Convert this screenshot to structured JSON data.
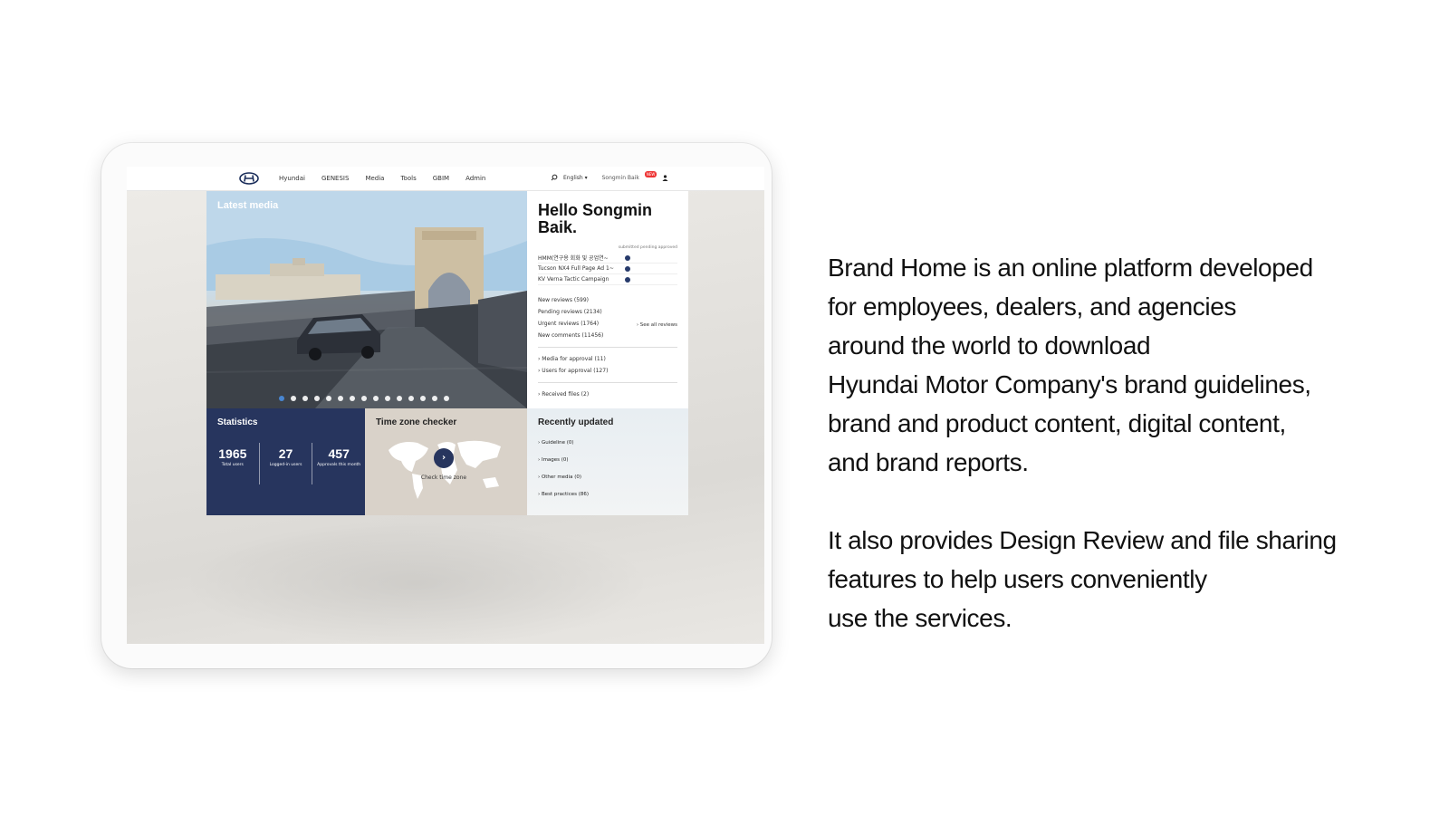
{
  "header": {
    "nav": [
      "Hyundai",
      "GENESIS",
      "Media",
      "Tools",
      "GBIM",
      "Admin"
    ],
    "language": "English",
    "user_name": "Songmin Baik",
    "badge": "NEW"
  },
  "hero": {
    "label": "Latest media",
    "slide_count": 15,
    "active_slide": 1
  },
  "welcome": {
    "greeting": "Hello Songmin Baik.",
    "legend": "submitted  pending  approved",
    "submissions": [
      "HMM(연구용 회화 및 공업연~",
      "Tucson NX4 Full Page Ad 1~",
      "KV Verna Tactic Campaign"
    ],
    "counts": [
      "New reviews (599)",
      "Pending reviews (2134)",
      "Urgent reviews (1764)",
      "New comments (11456)"
    ],
    "see_all": "› See all reviews",
    "approvals": [
      "› Media for approval (11)",
      "› Users for approval (127)"
    ],
    "received": "› Received files (2)"
  },
  "statistics": {
    "title": "Statistics",
    "items": [
      {
        "value": "1965",
        "label": "Total users"
      },
      {
        "value": "27",
        "label": "Logged-in users"
      },
      {
        "value": "457",
        "label": "Approvals this month"
      }
    ]
  },
  "timezone": {
    "title": "Time zone checker",
    "button": "›",
    "label": "Check time zone"
  },
  "recent": {
    "title": "Recently updated",
    "items": [
      "› Guideline (0)",
      "› Images (0)",
      "› Other media (0)",
      "› Best practices (86)"
    ]
  },
  "description": {
    "paragraph1": "Brand Home is an online platform developed\nfor employees, dealers, and agencies\naround the world to download\nHyundai Motor Company's brand guidelines,\nbrand and product content, digital content,\nand brand reports.",
    "paragraph2": "It also provides Design Review and file sharing\nfeatures to help users conveniently\nuse the services."
  },
  "colors": {
    "navy": "#27355e",
    "beige": "#d9d2c9"
  }
}
